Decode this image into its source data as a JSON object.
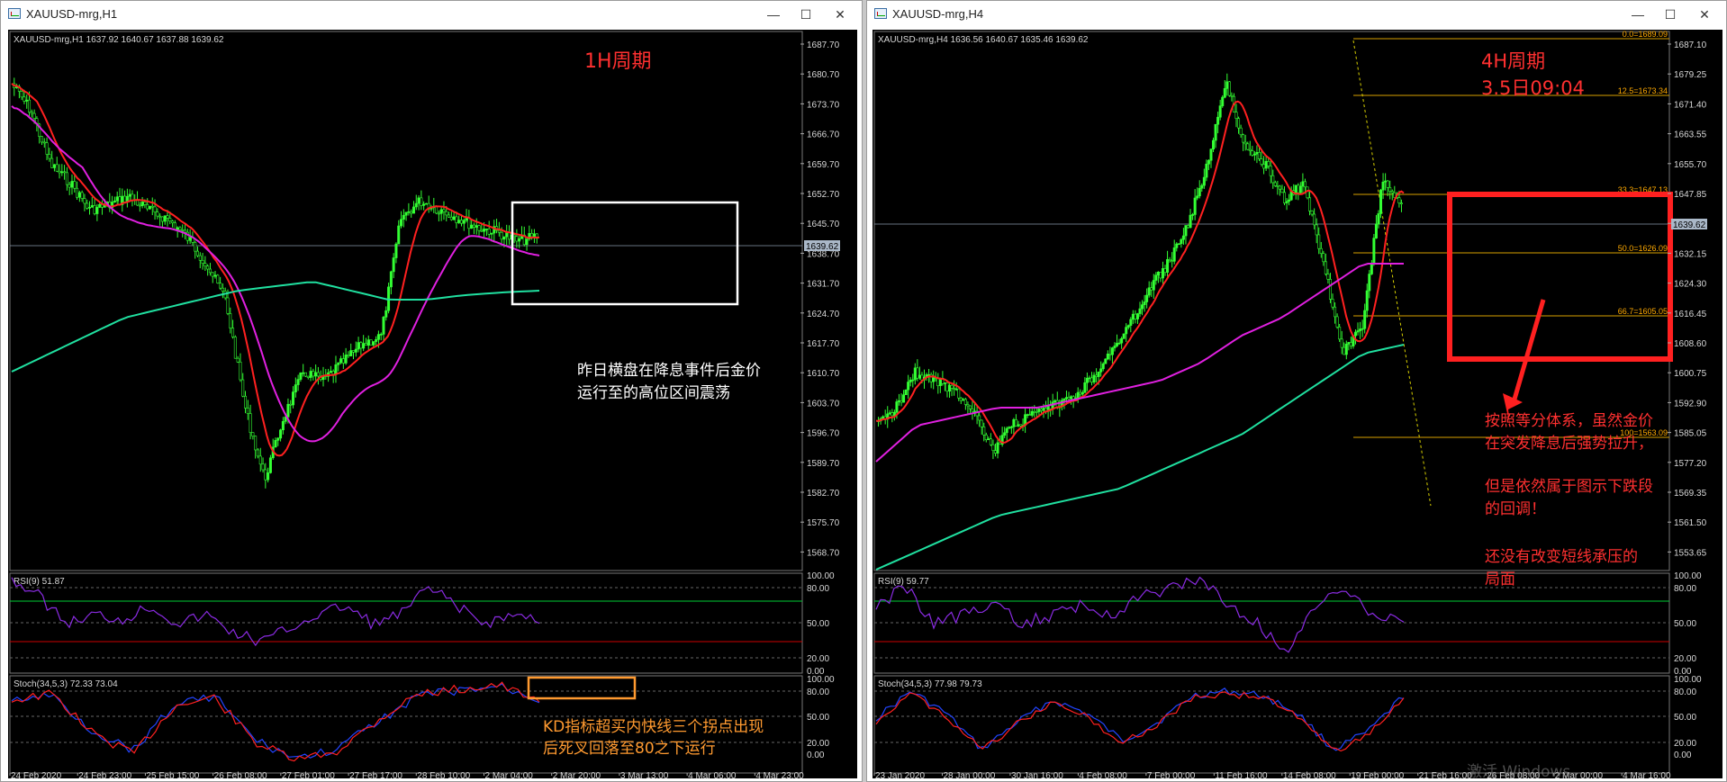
{
  "windows": [
    {
      "title": "XAUUSD-mrg,H1",
      "buttons": {
        "minimize": "—",
        "maximize": "☐",
        "close": "✕"
      },
      "info_text": "XAUUSD-mrg,H1  1637.92  1640.67  1637.88  1639.62",
      "current_price": "1639.62",
      "price_axis": [
        "1687.70",
        "1680.70",
        "1673.70",
        "1666.70",
        "1659.70",
        "1652.70",
        "1645.70",
        "1638.70",
        "1631.70",
        "1624.70",
        "1617.70",
        "1610.70",
        "1603.70",
        "1596.70",
        "1589.70",
        "1582.70",
        "1575.70",
        "1568.70"
      ],
      "time_axis": [
        "24 Feb 2020",
        "24 Feb 23:00",
        "25 Feb 15:00",
        "26 Feb 08:00",
        "27 Feb 01:00",
        "27 Feb 17:00",
        "28 Feb 10:00",
        "2 Mar 04:00",
        "2 Mar 20:00",
        "3 Mar 13:00",
        "4 Mar 06:00",
        "4 Mar 23:00"
      ],
      "rsi_label": "RSI(9) 51.87",
      "rsi_levels": [
        "100.00",
        "80.00",
        "50.00",
        "20.00",
        "0.00"
      ],
      "stoch_label": "Stoch(34,5,3) 72.33 73.04",
      "stoch_levels": [
        "100.00",
        "80.00",
        "50.00",
        "20.00",
        "0.00"
      ],
      "annotations": {
        "period": "1H周期",
        "note_line1": "昨日横盘在降息事件后金价",
        "note_line2": "运行至的高位区间震荡",
        "kd_line1": "KD指标超买内快线三个拐点出现",
        "kd_line2": "后死叉回落至80之下运行"
      }
    },
    {
      "title": "XAUUSD-mrg,H4",
      "buttons": {
        "minimize": "—",
        "maximize": "☐",
        "close": "✕"
      },
      "info_text": "XAUUSD-mrg,H4  1636.56  1640.67  1635.46  1639.62",
      "current_price": "1639.62",
      "price_axis": [
        "1687.10",
        "1679.25",
        "1671.40",
        "1663.55",
        "1655.70",
        "1647.85",
        "1640.00",
        "1632.15",
        "1624.30",
        "1616.45",
        "1608.60",
        "1600.75",
        "1592.90",
        "1585.05",
        "1577.20",
        "1569.35",
        "1561.50",
        "1553.65"
      ],
      "time_axis": [
        "23 Jan 2020",
        "28 Jan 00:00",
        "30 Jan 16:00",
        "4 Feb 08:00",
        "7 Feb 00:00",
        "11 Feb 16:00",
        "14 Feb 08:00",
        "19 Feb 00:00",
        "21 Feb 16:00",
        "26 Feb 08:00",
        "2 Mar 00:00",
        "4 Mar 16:00"
      ],
      "fib_levels": [
        "0.0=1689.09",
        "12.5=1673.34",
        "33.3=1647.13",
        "50.0=1626.09",
        "66.7=1605.05",
        "100=1563.09"
      ],
      "rsi_label": "RSI(9) 59.77",
      "rsi_levels": [
        "100.00",
        "80.00",
        "50.00",
        "20.00",
        "0.00"
      ],
      "stoch_label": "Stoch(34,5,3) 77.98 79.73",
      "stoch_levels": [
        "100.00",
        "80.00",
        "50.00",
        "20.00",
        "0.00"
      ],
      "annotations": {
        "period": "4H周期",
        "date": "3.5日09:04",
        "note1_line1": "按照等分体系，虽然金价",
        "note1_line2": "在突发降息后强势拉升，",
        "note2_line1": "但是依然属于图示下跌段",
        "note2_line2": "的回调！",
        "note3_line1": "还没有改变短线承压的",
        "note3_line2": "局面"
      },
      "watermark": "激活 Windows"
    }
  ],
  "colors": {
    "background": "#000000",
    "candle": "#33ff33",
    "ma_fast": "#ff2020",
    "ma_mid": "#e020e0",
    "ma_slow": "#20e0a0",
    "rsi_line": "#8a2be2",
    "stoch_main": "#2244ff",
    "stoch_signal": "#ff2020",
    "annotation_red": "#ff3030",
    "annotation_orange": "#ff9a30",
    "fib_line": "#d8a000"
  }
}
